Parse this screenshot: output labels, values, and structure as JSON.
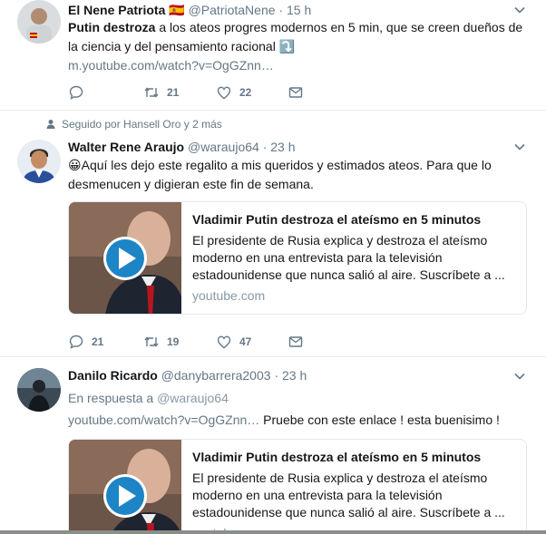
{
  "tweets": [
    {
      "name": "El Nene Patriota",
      "flag": "🇪🇸",
      "handle": "@PatriotaNene",
      "separator": "·",
      "time": "15 h",
      "text_bold": "Putin destroza",
      "text": " a los ateos progres modernos en 5 min, que se creen dueños de la ciencia y del pensamiento racional ",
      "text_emoji": "⤵️",
      "link": "m.youtube.com/watch?v=OgGZnn…",
      "actions": {
        "reply": "",
        "retweet": "21",
        "like": "22"
      }
    },
    {
      "context": "Seguido por Hansell Oro y 2 más",
      "name": "Walter Rene Araujo",
      "handle": "@waraujo64",
      "separator": "·",
      "time": "23 h",
      "text_emoji": "😀",
      "text": "Aquí les dejo este regalito a mis queridos y estimados ateos. Para que lo desmenucen y digieran este fin de semana.",
      "card": {
        "title": "Vladimir Putin destroza el ateísmo en 5 minutos",
        "description": "El presidente de Rusia explica y destroza el ateísmo moderno en una entrevista para la televisión estadounidense que nunca salió al aire. Suscríbete a ...",
        "domain": "youtube.com"
      },
      "actions": {
        "reply": "21",
        "retweet": "19",
        "like": "47"
      }
    },
    {
      "name": "Danilo Ricardo",
      "handle": "@danybarrera2003",
      "separator": "·",
      "time": "23 h",
      "reply_prefix": "En respuesta a",
      "reply_to": "@waraujo64",
      "link": "youtube.com/watch?v=OgGZnn…",
      "text": " Pruebe con este enlace ! esta buenisimo !",
      "card": {
        "title": "Vladimir Putin destroza el ateísmo en 5 minutos",
        "description": "El presidente de Rusia explica y destroza el ateísmo moderno en una entrevista para la televisión estadounidense que nunca salió al aire. Suscríbete a ...",
        "domain": "youtube.com"
      }
    }
  ],
  "colors": {
    "text": "#14171a",
    "secondary": "#657786",
    "link": "#8899a6",
    "border": "#e6ecf0",
    "play": "#1d84c6"
  },
  "icons": [
    "chevron-down-icon",
    "reply-icon",
    "retweet-icon",
    "like-icon",
    "message-icon",
    "person-icon",
    "play-icon"
  ]
}
